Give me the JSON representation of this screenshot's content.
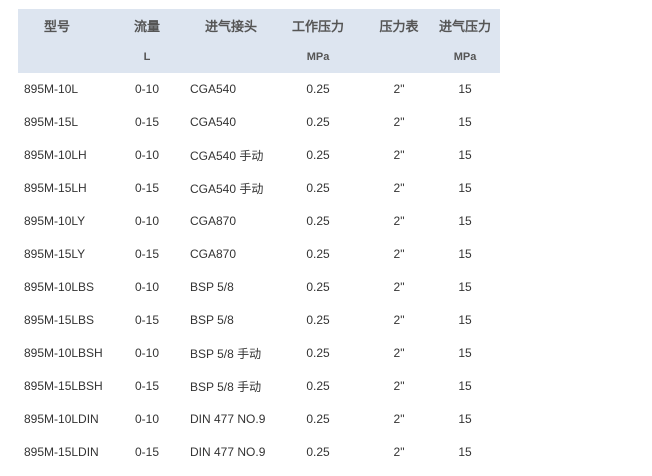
{
  "table": {
    "headers": [
      "型号",
      "流量",
      "进气接头",
      "工作压力",
      "压力表",
      "进气压力"
    ],
    "units": [
      "",
      "L",
      "",
      "MPa",
      "",
      "MPa"
    ],
    "rows": [
      [
        "895M-10L",
        "0-10",
        "CGA540",
        "0.25",
        "2\"",
        "15"
      ],
      [
        "895M-15L",
        "0-15",
        "CGA540",
        "0.25",
        "2\"",
        "15"
      ],
      [
        "895M-10LH",
        "0-10",
        "CGA540 手动",
        "0.25",
        "2\"",
        "15"
      ],
      [
        "895M-15LH",
        "0-15",
        "CGA540 手动",
        "0.25",
        "2\"",
        "15"
      ],
      [
        "895M-10LY",
        "0-10",
        "CGA870",
        "0.25",
        "2\"",
        "15"
      ],
      [
        "895M-15LY",
        "0-15",
        "CGA870",
        "0.25",
        "2\"",
        "15"
      ],
      [
        "895M-10LBS",
        "0-10",
        "BSP 5/8",
        "0.25",
        "2\"",
        "15"
      ],
      [
        "895M-15LBS",
        "0-15",
        "BSP 5/8",
        "0.25",
        "2\"",
        "15"
      ],
      [
        "895M-10LBSH",
        "0-10",
        "BSP 5/8 手动",
        "0.25",
        "2\"",
        "15"
      ],
      [
        "895M-15LBSH",
        "0-15",
        "BSP 5/8 手动",
        "0.25",
        "2\"",
        "15"
      ],
      [
        "895M-10LDIN",
        "0-10",
        "DIN 477 NO.9",
        "0.25",
        "2\"",
        "15"
      ],
      [
        "895M-15LDIN",
        "0-15",
        "DIN 477 NO.9",
        "0.25",
        "2\"",
        "15"
      ]
    ]
  },
  "colors": {
    "header_bg": "#dde5f0",
    "header_text": "#555555",
    "body_text": "#333333"
  }
}
